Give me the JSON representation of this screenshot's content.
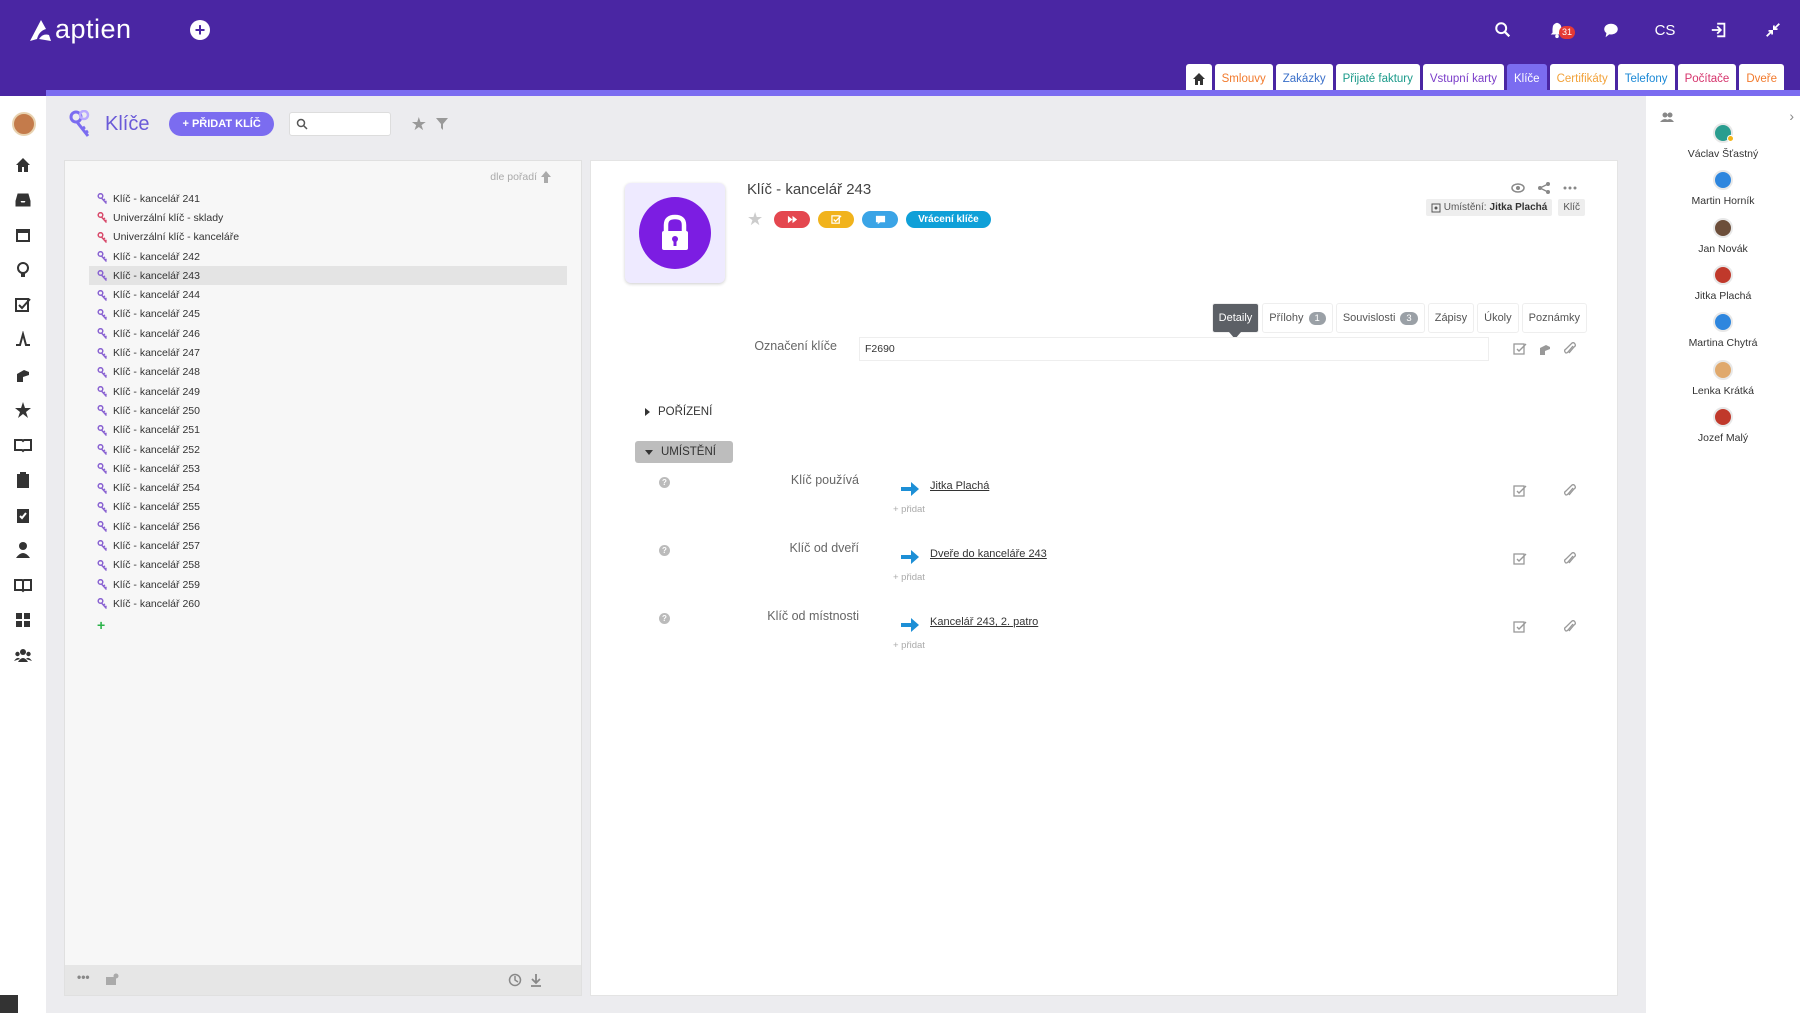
{
  "app": {
    "name": "aptien"
  },
  "topbar": {
    "lang": "CS",
    "notification_count": "31"
  },
  "tabs": [
    {
      "label": "Smlouvy",
      "color": "#f27a2d"
    },
    {
      "label": "Zakázky",
      "color": "#3a6fc9"
    },
    {
      "label": "Přijaté faktury",
      "color": "#1a9a8a"
    },
    {
      "label": "Vstupní karty",
      "color": "#7b3dc9"
    },
    {
      "label": "Klíče",
      "color": "#ffffff"
    },
    {
      "label": "Certifikáty",
      "color": "#f2a23a"
    },
    {
      "label": "Telefony",
      "color": "#1a88d6"
    },
    {
      "label": "Počítače",
      "color": "#d6336c"
    },
    {
      "label": "Dveře",
      "color": "#f27a2d"
    }
  ],
  "page": {
    "title": "Klíče",
    "add_button": "+ PŘIDAT KLÍČ",
    "search_placeholder": ""
  },
  "list": {
    "sort_label": "dle pořadí",
    "items": [
      {
        "label": "Klíč - kancelář 241",
        "red": false
      },
      {
        "label": "Univerzální klíč - sklady",
        "red": true
      },
      {
        "label": "Univerzální klíč - kanceláře",
        "red": true
      },
      {
        "label": "Klíč - kancelář 242",
        "red": false
      },
      {
        "label": "Klíč - kancelář 243",
        "red": false,
        "selected": true
      },
      {
        "label": "Klíč - kancelář 244",
        "red": false
      },
      {
        "label": "Klíč - kancelář 245",
        "red": false
      },
      {
        "label": "Klíč - kancelář 246",
        "red": false
      },
      {
        "label": "Klíč - kancelář 247",
        "red": false
      },
      {
        "label": "Klíč - kancelář 248",
        "red": false
      },
      {
        "label": "Klíč - kancelář 249",
        "red": false
      },
      {
        "label": "Klíč - kancelář 250",
        "red": false
      },
      {
        "label": "Klíč - kancelář 251",
        "red": false
      },
      {
        "label": "Klíč - kancelář 252",
        "red": false
      },
      {
        "label": "Klíč - kancelář 253",
        "red": false
      },
      {
        "label": "Klíč - kancelář 254",
        "red": false
      },
      {
        "label": "Klíč - kancelář 255",
        "red": false
      },
      {
        "label": "Klíč - kancelář 256",
        "red": false
      },
      {
        "label": "Klíč - kancelář 257",
        "red": false
      },
      {
        "label": "Klíč - kancelář 258",
        "red": false
      },
      {
        "label": "Klíč - kancelář 259",
        "red": false
      },
      {
        "label": "Klíč - kancelář 260",
        "red": false
      }
    ]
  },
  "detail": {
    "title": "Klíč - kancelář 243",
    "return_badge": "Vrácení klíče",
    "location_label": "Umístění:",
    "location_value": "Jitka Plachá",
    "type_badge": "Klíč",
    "tabs": [
      {
        "label": "Detaily",
        "active": true
      },
      {
        "label": "Přílohy",
        "count": "1"
      },
      {
        "label": "Souvislosti",
        "count": "3"
      },
      {
        "label": "Zápisy"
      },
      {
        "label": "Úkoly"
      },
      {
        "label": "Poznámky"
      }
    ],
    "designation_label": "Označení klíče",
    "designation_value": "F2690",
    "section_purchase": "POŘÍZENÍ",
    "section_location": "UMÍSTĚNÍ",
    "relations": [
      {
        "label": "Klíč používá",
        "link": "Jitka Plachá",
        "add": "+ přidat"
      },
      {
        "label": "Klíč od dveří",
        "link": "Dveře do kanceláře 243",
        "add": "+ přidat"
      },
      {
        "label": "Klíč od místnosti",
        "link": "Kancelář 243, 2. patro",
        "add": "+ přidat"
      }
    ]
  },
  "people": [
    {
      "name": "Václav Šťastný",
      "color": "#2a9d8f",
      "online": true
    },
    {
      "name": "Martin Horník",
      "color": "#2e86de",
      "online": false
    },
    {
      "name": "Jan Novák",
      "color": "#6c4e3a",
      "online": false
    },
    {
      "name": "Jitka Plachá",
      "color": "#c0392b",
      "online": false
    },
    {
      "name": "Martina Chytrá",
      "color": "#2e86de",
      "online": false
    },
    {
      "name": "Lenka Krátká",
      "color": "#e0a96d",
      "online": false
    },
    {
      "name": "Jozef Malý",
      "color": "#c0392b",
      "online": false
    }
  ]
}
